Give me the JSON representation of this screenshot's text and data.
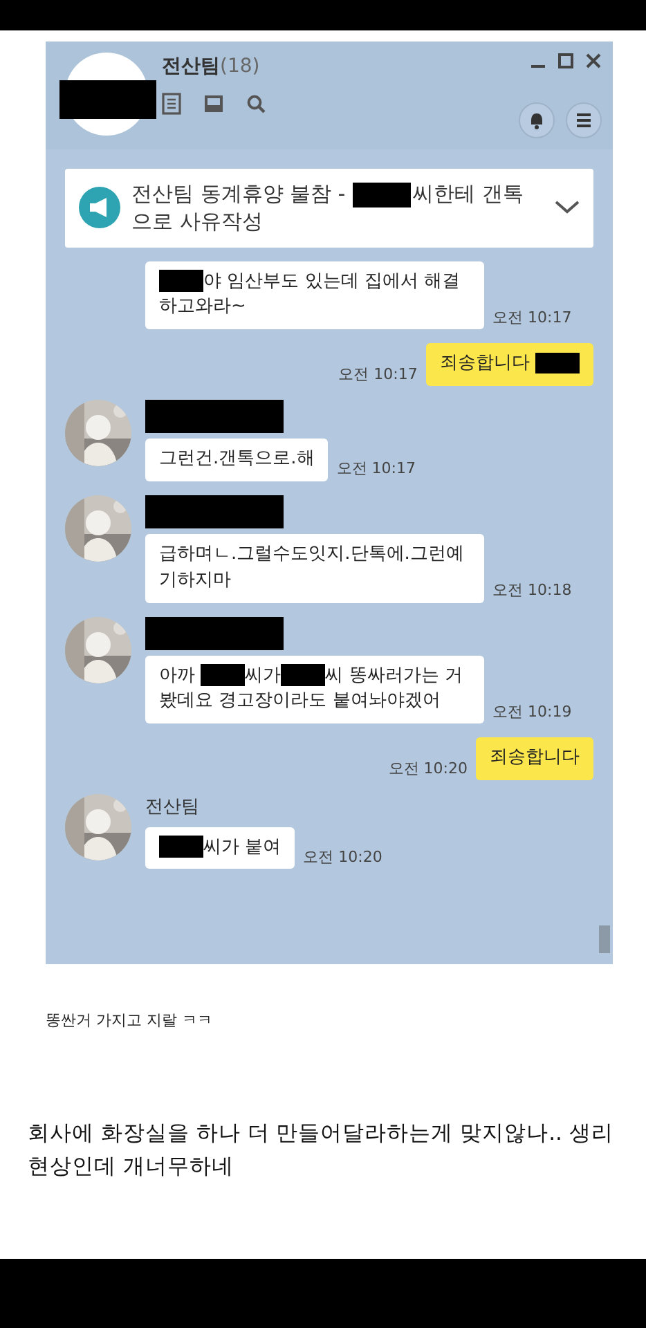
{
  "chat_window": {
    "title": "전산팀",
    "member_count": "(18)",
    "notice": {
      "parts": [
        {
          "kind": "text",
          "text": "전산팀 동계휴양 불참 - "
        },
        {
          "kind": "redacted"
        },
        {
          "kind": "text",
          "text": "씨한테 갠톡으로 사유작성"
        }
      ]
    },
    "messages": [
      {
        "kind": "received",
        "parts": [
          {
            "kind": "redacted"
          },
          {
            "kind": "text",
            "text": "야 임산부도 있는데 집에서 해결하고와라~"
          }
        ],
        "time": "오전 10:17"
      },
      {
        "kind": "sent",
        "parts": [
          {
            "kind": "text",
            "text": "죄송합니다 "
          },
          {
            "kind": "redacted"
          }
        ],
        "time": "오전 10:17"
      },
      {
        "kind": "received",
        "sender": [
          {
            "kind": "redacted"
          }
        ],
        "parts": [
          {
            "kind": "text",
            "text": "그런건.갠톡으로.해"
          }
        ],
        "time": "오전 10:17"
      },
      {
        "kind": "received",
        "sender": [
          {
            "kind": "redacted"
          }
        ],
        "parts": [
          {
            "kind": "text",
            "text": "급하며ㄴ.그럴수도잇지.단톡에.그런예기하지마"
          }
        ],
        "time": "오전 10:18"
      },
      {
        "kind": "received",
        "sender": [
          {
            "kind": "redacted"
          }
        ],
        "parts": [
          {
            "kind": "text",
            "text": "아까 "
          },
          {
            "kind": "redacted"
          },
          {
            "kind": "text",
            "text": "씨가"
          },
          {
            "kind": "redacted"
          },
          {
            "kind": "text",
            "text": "씨 똥싸러가는 거 봤데요 경고장이라도 붙여놔야겠어"
          }
        ],
        "time": "오전 10:19"
      },
      {
        "kind": "sent",
        "parts": [
          {
            "kind": "text",
            "text": "죄송합니다"
          }
        ],
        "time": "오전 10:20"
      },
      {
        "kind": "received",
        "sender": [
          {
            "kind": "text",
            "text": "전산팀"
          }
        ],
        "parts": [
          {
            "kind": "redacted"
          },
          {
            "kind": "text",
            "text": "씨가 붙여"
          }
        ],
        "time": "오전 10:20"
      }
    ]
  },
  "post": {
    "caption": "똥싼거 가지고 지랄 ㅋㅋ",
    "comment": "회사에 화장실을 하나 더 만들어달라하는게 맞지않나.. 생리 현상인데 개너무하네"
  }
}
